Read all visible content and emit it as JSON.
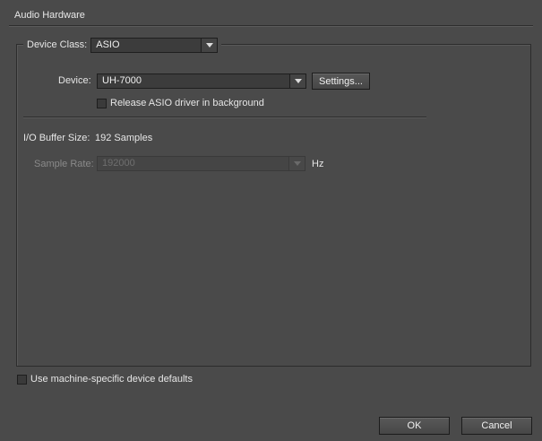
{
  "section": {
    "title": "Audio Hardware"
  },
  "device_class": {
    "label": "Device Class:",
    "value": "ASIO"
  },
  "device": {
    "label": "Device:",
    "value": "UH-7000",
    "settings_button": "Settings..."
  },
  "release_option": {
    "label": "Release ASIO driver in background",
    "checked": false
  },
  "buffer": {
    "label": "I/O Buffer Size:",
    "value": "192 Samples"
  },
  "sample_rate": {
    "label": "Sample Rate:",
    "value": "192000",
    "unit": "Hz",
    "enabled": false
  },
  "machine_defaults": {
    "label": "Use machine-specific device defaults",
    "checked": false
  },
  "buttons": {
    "ok": "OK",
    "cancel": "Cancel"
  },
  "icons": {
    "dropdown_arrow": "chevron-down-icon",
    "checkbox": "checkbox-icon"
  }
}
